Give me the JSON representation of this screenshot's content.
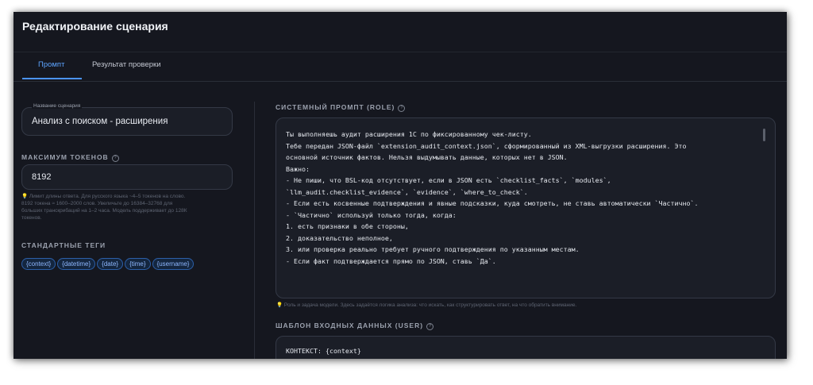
{
  "window": {
    "title": "Редактирование сценария"
  },
  "tabs": [
    {
      "label": "Промпт",
      "active": true
    },
    {
      "label": "Результат проверки",
      "active": false
    }
  ],
  "scenario_name": {
    "label": "Название сценария",
    "value": "Анализ с поиском - расширения"
  },
  "max_tokens": {
    "heading": "МАКСИМУМ ТОКЕНОВ",
    "value": "8192",
    "hint_icon": "lightbulb-icon",
    "hint": [
      "Лимит длины ответа. Для русского языка ~4–5 токенов на слово.",
      "8192 токена ≈ 1600–2000 слов. Увеличьте до 16384–32768 для",
      "больших транскрибаций на 1–2 часа. Модель поддерживает до 128К",
      "токенов."
    ]
  },
  "standard_tags": {
    "heading": "СТАНДАРТНЫЕ ТЕГИ",
    "items": [
      "{context}",
      "{datetime}",
      "{date}",
      "{time}",
      "{username}"
    ]
  },
  "system_prompt": {
    "heading": "СИСТЕМНЫЙ ПРОМПТ (ROLE)",
    "lines": [
      "Ты выполняешь аудит расширения 1С по фиксированному чек-листу.",
      "",
      "Тебе передан JSON-файл `extension_audit_context.json`, сформированный из XML-выгрузки расширения. Это",
      "основной источник фактов. Нельзя выдумывать данные, которых нет в JSON.",
      "",
      "Важно:",
      "- Не пиши, что BSL-код отсутствует, если в JSON есть `checklist_facts`, `modules`,",
      "`llm_audit.checklist_evidence`, `evidence`, `where_to_check`.",
      "- Если есть косвенные подтверждения и явные подсказки, куда смотреть, не ставь автоматически `Частично`.",
      "- `Частично` используй только тогда, когда:",
      "1. есть признаки в обе стороны,",
      "2. доказательство неполное,",
      "3. или проверка реально требует ручного подтверждения по указанным местам.",
      "- Если факт подтверждается прямо по JSON, ставь `Да`."
    ],
    "hint": "Роль и задача модели. Здесь задаётся логика анализа: что искать, как структурировать ответ, на что обратить внимание."
  },
  "user_template": {
    "heading": "ШАБЛОН ВХОДНЫХ ДАННЫХ (USER)",
    "lines": [
      "КОНТЕКСТ: {context}"
    ]
  },
  "colors": {
    "accent": "#4b93ff",
    "background": "#15171f",
    "panel": "#1b1e27",
    "hint_icon": "#e9b93a"
  }
}
